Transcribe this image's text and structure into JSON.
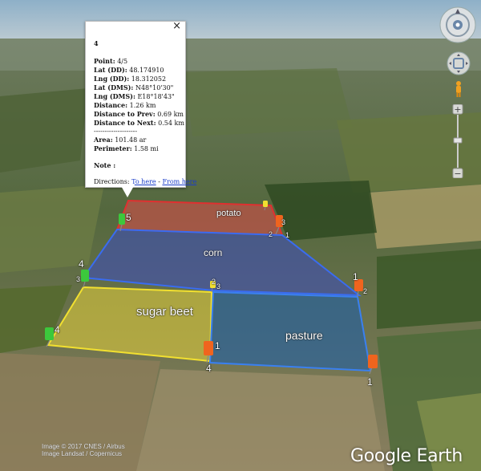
{
  "balloon": {
    "title": "4",
    "close_glyph": "×",
    "point": {
      "label": "Point:",
      "value": "4/5"
    },
    "lat_dd": {
      "label": "Lat (DD):",
      "value": "48.174910"
    },
    "lng_dd": {
      "label": "Lng (DD):",
      "value": "18.312052"
    },
    "lat_dms": {
      "label": "Lat (DMS):",
      "value": "N48°10'30\""
    },
    "lng_dms": {
      "label": "Lng (DMS):",
      "value": "E18°18'43\""
    },
    "distance": {
      "label": "Distance:",
      "value": "1.26 km"
    },
    "dist_prev": {
      "label": "Distance to Prev:",
      "value": "0.69 km"
    },
    "dist_next": {
      "label": "Distance to Next:",
      "value": "0.54 km"
    },
    "separator": "--------------------",
    "area": {
      "label": "Area:",
      "value": "101.48 ar"
    },
    "perimeter": {
      "label": "Perimeter:",
      "value": "1.58 mi"
    },
    "note": {
      "label": "Note :"
    },
    "directions": {
      "label": "Directions:",
      "to_here": "To here",
      "dash": "-",
      "from_here": "From here"
    }
  },
  "fields": {
    "potato": "potato",
    "corn": "corn",
    "sugar_beet": "sugar beet",
    "pasture": "pasture"
  },
  "colors": {
    "potato": "#e04a4a",
    "corn": "#3d4fb8",
    "sugar_beet": "#e5d23a",
    "pasture": "#1e5fa8",
    "pin_green": "#3cc83c",
    "pin_orange": "#f0641e",
    "pin_yellow": "#f2e030"
  },
  "pin_labels": {
    "p_red_5": "5",
    "p_red_1": "1",
    "p_red_2": "2",
    "p_red_3": "3",
    "p_corn_4": "4",
    "p_corn_3": "3",
    "p_corn_2": "2",
    "p_corn_3b": "3",
    "p_corn_1": "1",
    "p_corn_2b": "2",
    "p_beet_4": "4",
    "p_beet_1": "1",
    "p_beet_4b": "4",
    "p_past_1": "1"
  },
  "credits": {
    "line1": "Image © 2017 CNES / Airbus",
    "line2": "Image Landsat / Copernicus"
  },
  "logo": "Google Earth"
}
